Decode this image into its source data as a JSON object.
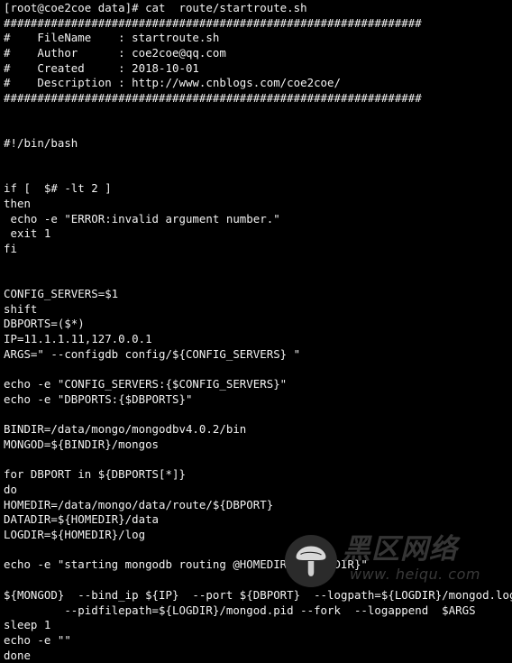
{
  "terminal": {
    "background_color": "#000000",
    "foreground_color": "#f2f2f2",
    "prompt": "[root@coe2coe data]# cat  route/startroute.sh",
    "lines": [
      "[root@coe2coe data]# cat  route/startroute.sh",
      "##############################################################",
      "#    FileName    : startroute.sh",
      "#    Author      : coe2coe@qq.com",
      "#    Created     : 2018-10-01",
      "#    Description : http://www.cnblogs.com/coe2coe/",
      "##############################################################",
      "",
      "",
      "#!/bin/bash",
      "",
      "",
      "if [  $# -lt 2 ]",
      "then",
      " echo -e \"ERROR:invalid argument number.\"",
      " exit 1",
      "fi",
      "",
      "",
      "CONFIG_SERVERS=$1",
      "shift",
      "DBPORTS=($*)",
      "IP=11.1.1.11,127.0.0.1",
      "ARGS=\" --configdb config/${CONFIG_SERVERS} \"",
      "",
      "echo -e \"CONFIG_SERVERS:{$CONFIG_SERVERS}\"",
      "echo -e \"DBPORTS:{$DBPORTS}\"",
      "",
      "BINDIR=/data/mongo/mongodbv4.0.2/bin",
      "MONGOD=${BINDIR}/mongos",
      "",
      "for DBPORT in ${DBPORTS[*]}",
      "do",
      "HOMEDIR=/data/mongo/data/route/${DBPORT}",
      "DATADIR=${HOMEDIR}/data",
      "LOGDIR=${HOMEDIR}/log",
      "",
      "echo -e \"starting mongodb routing @HOMEDIR:{$HOMEDIR}\"",
      "",
      "${MONGOD}  --bind_ip ${IP}  --port ${DBPORT}  --logpath=${LOGDIR}/mongod.log\\",
      "         --pidfilepath=${LOGDIR}/mongod.pid --fork  --logappend  $ARGS",
      "sleep 1",
      "echo -e \"\"",
      "done"
    ]
  },
  "watermark": {
    "cn_text": "黑区网络",
    "url_text": "www. heiqu. com",
    "logo_icon": "mushroom-icon",
    "disc_color": "#2b2b2b",
    "text_color": "#353535"
  }
}
